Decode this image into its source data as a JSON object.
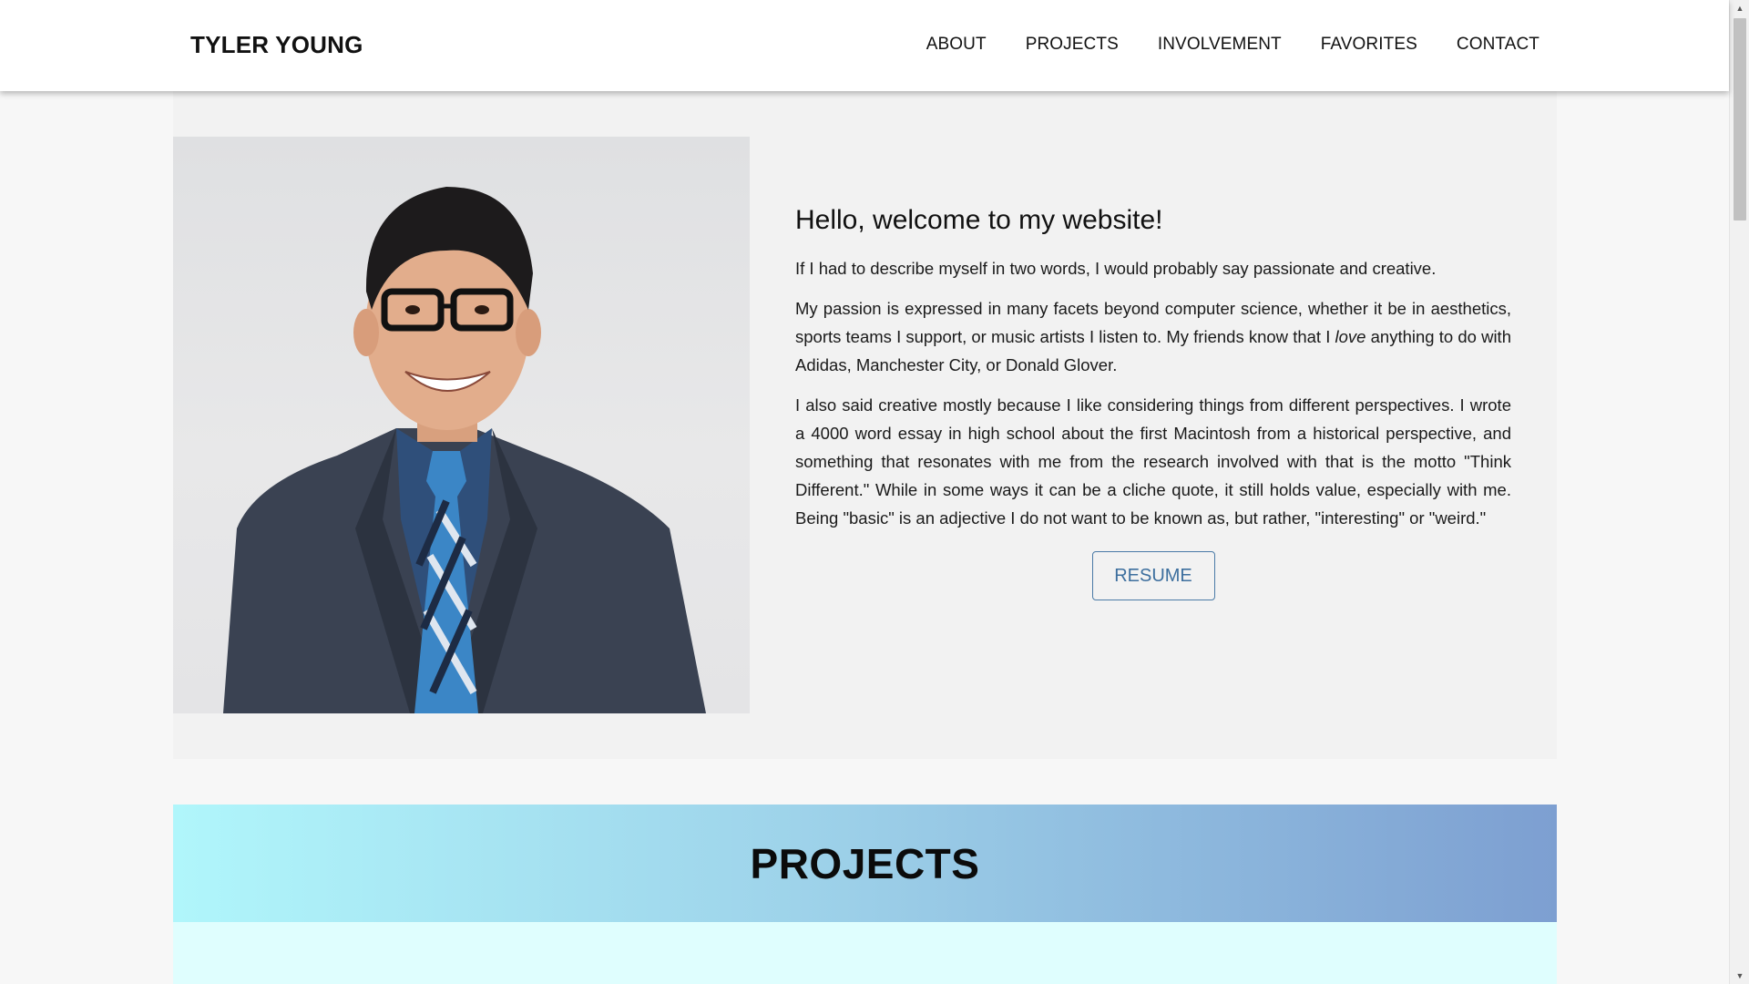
{
  "header": {
    "brand": "TYLER YOUNG",
    "nav": [
      "ABOUT",
      "PROJECTS",
      "INVOLVEMENT",
      "FAVORITES",
      "CONTACT"
    ]
  },
  "about": {
    "title": "Hello, welcome to my website!",
    "p1": "If I had to describe myself in two words, I would probably say passionate and creative.",
    "p2_before": "My passion is expressed in many facets beyond computer science, whether it be in aesthetics, sports teams I support, or music artists I listen to. My friends know that I ",
    "p2_em": "love",
    "p2_after": " anything to do with Adidas, Manchester City, or Donald Glover.",
    "p3": "I also said creative mostly because I like considering things from different perspectives. I wrote a 4000 word essay in high school about the first Macintosh from a historical perspective, and something that resonates with me from the research involved with that is the motto \"Think Different.\" While in some ways it can be a cliche quote, it still holds value, especially with me. Being \"basic\" is an adjective I do not want to be known as, but rather, \"interesting\" or \"weird.\"",
    "resume_label": "RESUME"
  },
  "projects": {
    "title": "PROJECTS"
  },
  "colors": {
    "accent": "#3d6f9e",
    "banner_start": "#b0f6fb",
    "banner_end": "#7d9fd1"
  },
  "icons": {
    "scroll_up": "triangle-up-icon",
    "scroll_down": "triangle-down-icon"
  }
}
